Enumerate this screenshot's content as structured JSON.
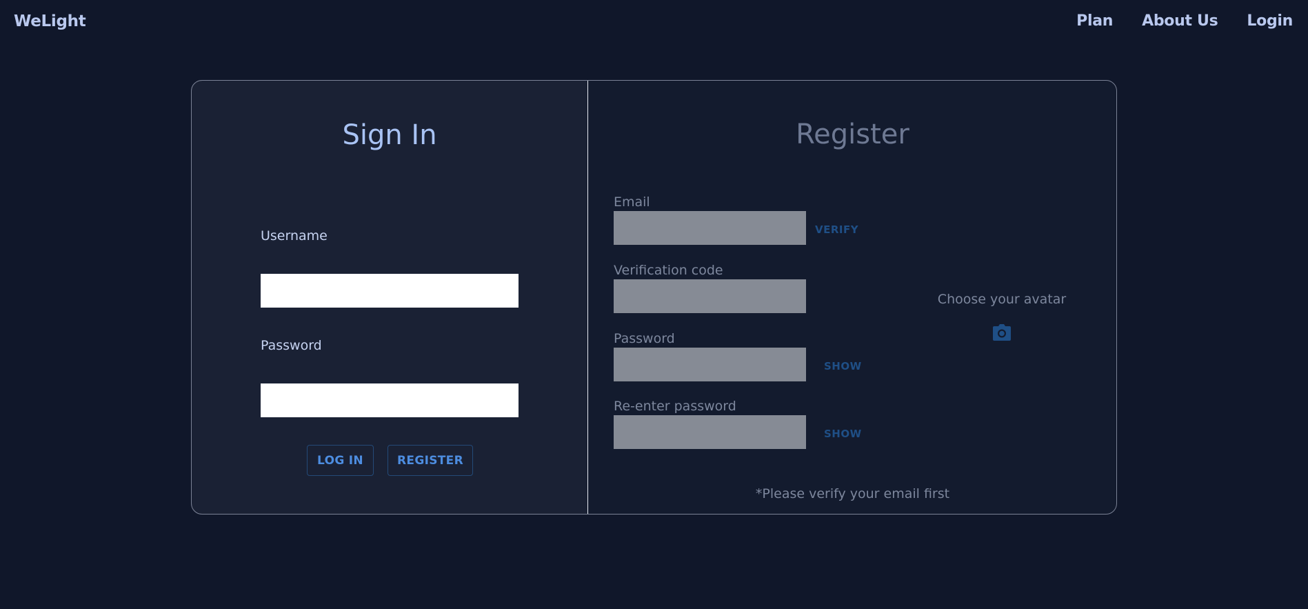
{
  "navbar": {
    "brand": "WeLight",
    "links": [
      "Plan",
      "About Us",
      "Login"
    ]
  },
  "signin": {
    "title": "Sign In",
    "username_label": "Username",
    "username_value": "",
    "password_label": "Password",
    "password_value": "",
    "login_button": "LOG IN",
    "register_button": "REGISTER"
  },
  "register": {
    "title": "Register",
    "email_label": "Email",
    "email_value": "",
    "verify_button": "VERIFY",
    "code_label": "Verification code",
    "code_value": "",
    "password_label": "Password",
    "password_value": "",
    "show_password_button": "SHOW",
    "reenter_label": "Re-enter password",
    "reenter_value": "",
    "show_reenter_button": "SHOW",
    "avatar_label": "Choose your avatar",
    "avatar_icon": "camera-icon",
    "notice": "*Please verify your email first"
  },
  "colors": {
    "background": "#10172a",
    "signin_panel": "#1a2134",
    "register_panel": "#131b2e",
    "accent": "#4d8de0",
    "title_blue": "#a9c3f4",
    "muted_text": "#7d879d",
    "disabled_input": "#868b95"
  }
}
